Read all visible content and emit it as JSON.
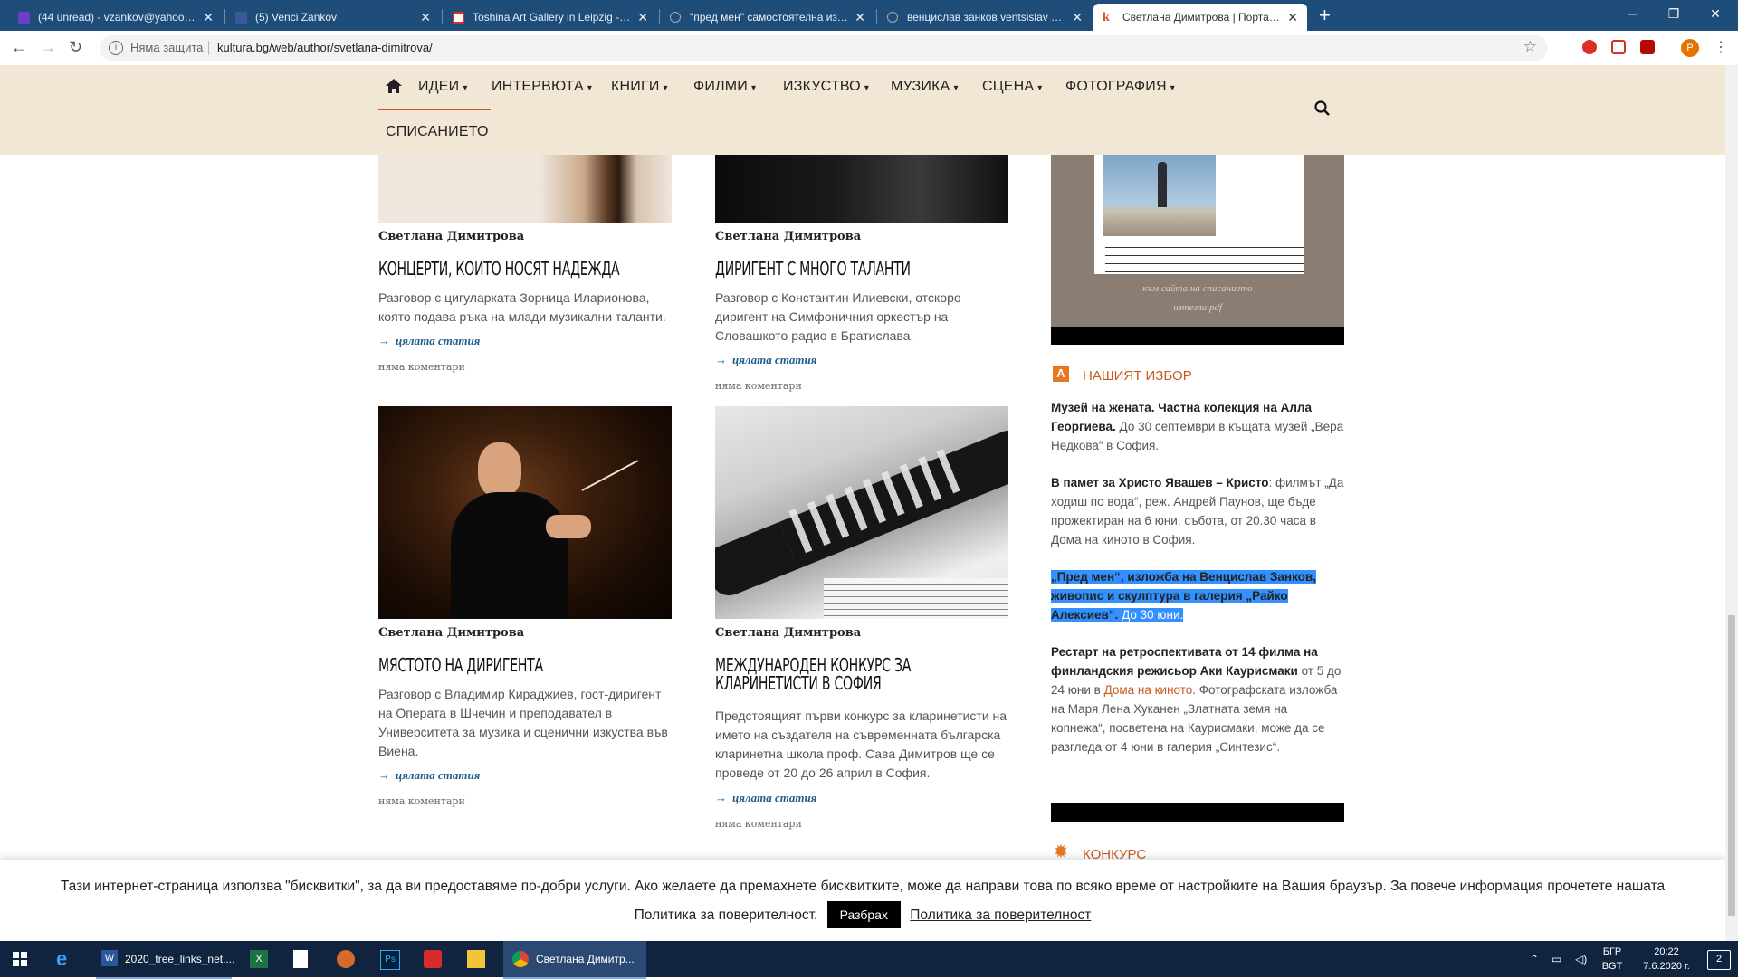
{
  "browser": {
    "tabs": [
      {
        "label": "(44 unread) - vzankov@yahoo.com",
        "color": "#6e3fc9"
      },
      {
        "label": "(5) Venci Zankov",
        "color": "#3b5998"
      },
      {
        "label": "Toshina Art Gallery in Leipzig - vz",
        "color": "#d93025"
      },
      {
        "label": "\"пред мен\" самостоятелна изло",
        "color": "#888888"
      },
      {
        "label": "венцислав занков ventsislav zan",
        "color": "#888888"
      },
      {
        "label": "Светлана Димитрова | Портал з",
        "color": "#c85a1b"
      }
    ],
    "not_secure": "Няма защита",
    "url": "kultura.bg/web/author/svetlana-dimitrova/",
    "profile_initial": "P"
  },
  "nav": {
    "items": [
      "ИДЕИ",
      "ИНТЕРВЮТА",
      "КНИГИ",
      "ФИЛМИ",
      "ИЗКУСТВО",
      "МУЗИКА",
      "СЦЕНА",
      "ФОТОГРАФИЯ"
    ],
    "second_row": "СПИСАНИЕТО"
  },
  "articles": [
    {
      "author": "Светлана Димитрова",
      "title": "Концерти, които носят надежда",
      "excerpt": "Разговор с цигуларката Зорница Иларионова, която подава ръка на млади музикални таланти.",
      "readmore": "цялата статия",
      "comments": "няма коментари"
    },
    {
      "author": "Светлана Димитрова",
      "title": "Диригент с много таланти",
      "excerpt": "Разговор с Константин Илиевски, отскоро диригент на Симфоничния оркестър на Словашкото радио в Братислава.",
      "readmore": "цялата статия",
      "comments": "няма коментари"
    },
    {
      "author": "Светлана Димитрова",
      "title": "Мястото на диригента",
      "excerpt": "Разговор с Владимир Кираджиев, гост-диригент на Операта в Шчечин и преподавател в Университета за музика и сценични изкуства във Виена.",
      "readmore": "цялата статия",
      "comments": "няма коментари"
    },
    {
      "author": "Светлана Димитрова",
      "title": "Международен конкурс за кларинетисти в София",
      "excerpt": "Предстоящият първи конкурс за кларинетисти на името на създателя на съвременната българска кларинетна школа проф. Сава Димитров ще се проведе от 20 до 26 април в София.",
      "readmore": "цялата статия",
      "comments": "няма коментари"
    }
  ],
  "sidebar": {
    "magazine_caption1": "към сайта на списанието",
    "magazine_caption2": "изтегли pdf",
    "our_choice_title": "НАШИЯТ ИЗБОР",
    "our_choice_icon": "A",
    "items": [
      {
        "bold": "Музей на жената. Частна колекция на Алла Георгиева.",
        "text": " До 30 септември в къщата музей „Вера Недкова“ в София."
      },
      {
        "bold": "В памет за Христо Явашев – Кристо",
        "text": ": филмът „Да ходиш по вода“, реж. Андрей Паунов, ще бъде прожектиран на 6 юни, събота, от 20.30 часа в Дома на киното в София."
      },
      {
        "bold": "„Пред мен“, изложба на Венцислав Занков, живопис и скулптура в галерия „Райко Алексиев“.",
        "text": " До 30 юни."
      },
      {
        "bold": "Рестарт на ретроспективата от 14 филма на финландския режисьор Аки Каурисмаки",
        "text": " от 5 до 24 юни в ",
        "link": "Дома на киното",
        "text2": ". Фотографската изложба на Маря Лена Хуканен „Златната земя на копнежа“, посветена на Каурисмаки, може да се разгледа от 4 юни в галерия „Синтезис“."
      }
    ],
    "contest_title": "КОНКУРС"
  },
  "cookie": {
    "text": "Тази интернет-страница използва \"бисквитки\", за да ви предоставяме по-добри услуги. Ако желаете да премахнете бисквитките, може да направи това по всяко време от настройките на Вашия браузър. За повече информация прочетете нашата",
    "text2": "Политика за поверителност.",
    "button": "Разбрах",
    "link": "Политика за поверителност"
  },
  "taskbar": {
    "word_label": "2020_tree_links_net....",
    "chrome_label": "Светлана Димитр...",
    "lang1": "БГР",
    "lang2": "BGT",
    "time": "20:22",
    "date": "7.6.2020 г.",
    "notif_count": "2"
  }
}
